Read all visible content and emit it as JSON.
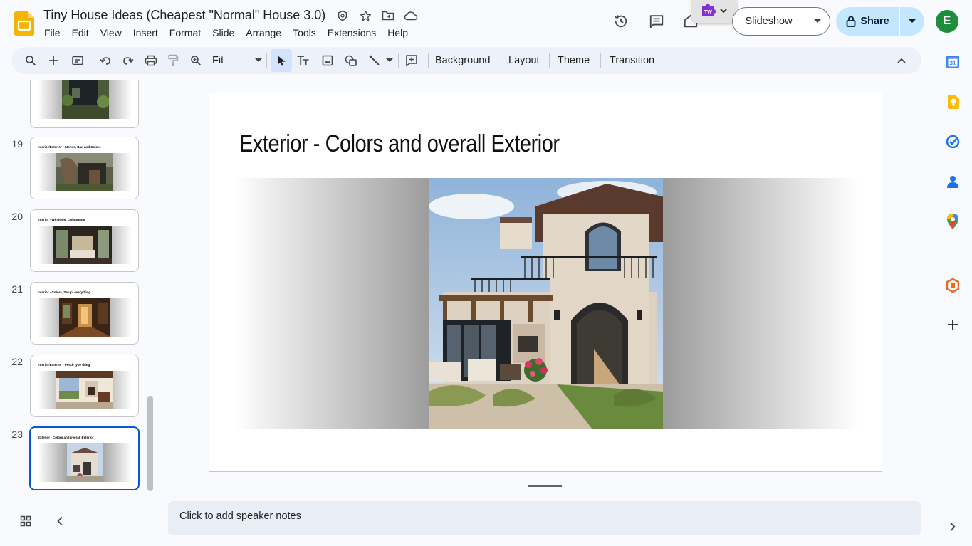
{
  "app": {
    "doc_title": "Tiny House Ideas (Cheapest \"Normal\" House 3.0)",
    "menu": [
      "File",
      "Edit",
      "View",
      "Insert",
      "Format",
      "Slide",
      "Arrange",
      "Tools",
      "Extensions",
      "Help"
    ],
    "slideshow_label": "Slideshow",
    "share_label": "Share",
    "avatar_initial": "E",
    "accent_color": "#0b57d0",
    "share_bg": "#c2e7ff"
  },
  "toolbar": {
    "zoom_value": "Fit",
    "background_label": "Background",
    "layout_label": "Layout",
    "theme_label": "Theme",
    "transition_label": "Transition"
  },
  "filmstrip": {
    "slides": [
      {
        "number": "",
        "title": ""
      },
      {
        "number": "19",
        "title": "Interior/Exterior - Stones, Bar, and Colors"
      },
      {
        "number": "20",
        "title": "Interior - Windows, Livingroom"
      },
      {
        "number": "21",
        "title": "Interior - Colors, Setup, everything"
      },
      {
        "number": "22",
        "title": "Interior/Exterior - Porch type thing"
      },
      {
        "number": "23",
        "title": "Exterior - Colors and overall Exterior"
      }
    ],
    "selected_slide": "23"
  },
  "slide": {
    "title": "Exterior - Colors and overall Exterior"
  },
  "notes": {
    "placeholder": "Click to add speaker notes"
  }
}
